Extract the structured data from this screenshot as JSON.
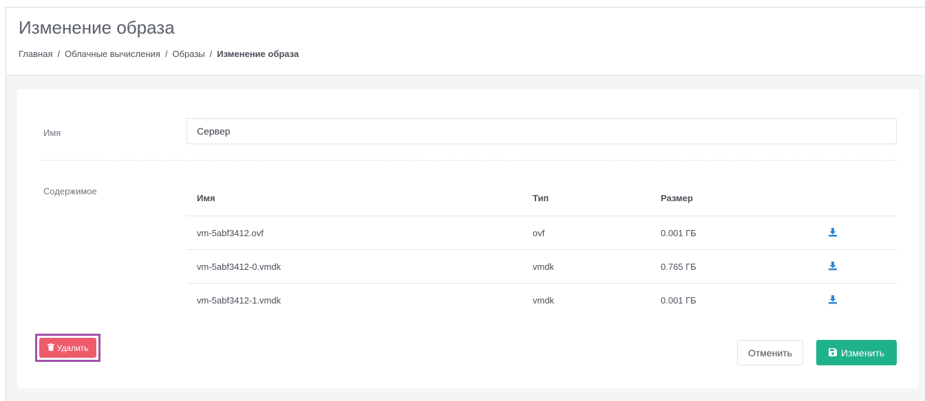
{
  "header": {
    "title": "Изменение образа",
    "breadcrumb": [
      {
        "label": "Главная"
      },
      {
        "label": "Облачные вычисления"
      },
      {
        "label": "Образы"
      },
      {
        "label": "Изменение образа"
      }
    ],
    "separator": "/"
  },
  "form": {
    "name_label": "Имя",
    "name_value": "Сервер",
    "content_label": "Содержимое"
  },
  "table": {
    "headers": {
      "name": "Имя",
      "type": "Тип",
      "size": "Размер"
    },
    "rows": [
      {
        "name": "vm-5abf3412.ovf",
        "type": "ovf",
        "size": "0.001 ГБ",
        "icon": "download-icon"
      },
      {
        "name": "vm-5abf3412-0.vmdk",
        "type": "vmdk",
        "size": "0.765 ГБ",
        "icon": "download-icon"
      },
      {
        "name": "vm-5abf3412-1.vmdk",
        "type": "vmdk",
        "size": "0.001 ГБ",
        "icon": "download-icon"
      }
    ]
  },
  "actions": {
    "delete_label": "Удалить",
    "cancel_label": "Отменить",
    "save_label": "Изменить"
  },
  "colors": {
    "delete": "#ef5b6b",
    "save": "#1fb18a",
    "highlight": "#a351a8",
    "download": "#2b86d9"
  }
}
